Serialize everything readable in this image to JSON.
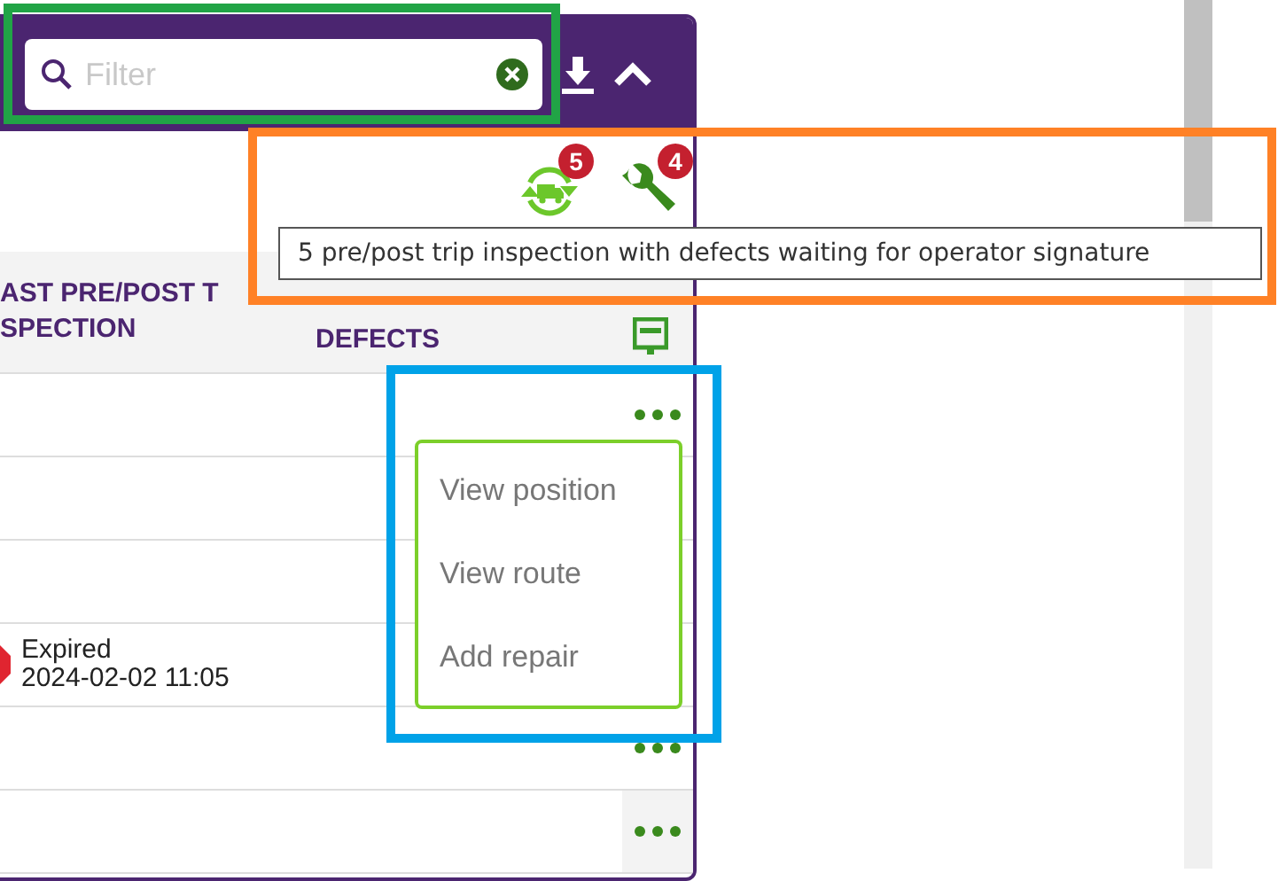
{
  "filter": {
    "placeholder": "Filter"
  },
  "alerts": [
    {
      "kind": "inspection",
      "badge": "5"
    },
    {
      "kind": "repair",
      "badge": "4"
    }
  ],
  "tooltip": "5 pre/post trip inspection with defects waiting for operator signature",
  "table": {
    "columns": [
      {
        "lines": [
          "AST PRE/POST T",
          "SPECTION"
        ]
      },
      {
        "lines": [
          "DEFECTS"
        ]
      }
    ],
    "rows": [
      {
        "more_button": true
      },
      {
        "more_button": false
      },
      {
        "more_button": false
      },
      {
        "more_button": false,
        "status": [
          "Expired",
          "2024-02-02 11:05"
        ]
      },
      {
        "more_button": true
      },
      {
        "more_button": true
      }
    ]
  },
  "menu": [
    "View position",
    "View route",
    "Add repair"
  ],
  "highlights": [
    {
      "color": "#21a446"
    },
    {
      "color": "#ff8126"
    },
    {
      "color": "#00a2e8"
    }
  ]
}
